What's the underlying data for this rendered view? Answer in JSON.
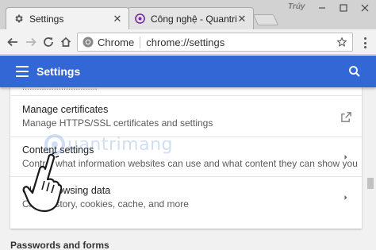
{
  "tabs": [
    {
      "title": "Settings",
      "icon": "gear-icon",
      "active": true
    },
    {
      "title": "Công nghệ - Quantrimang",
      "icon": "quantrimang-icon",
      "active": false
    }
  ],
  "window_user_label": "Trúy",
  "omnibox": {
    "chip": "Chrome",
    "url": "chrome://settings"
  },
  "header": {
    "title": "Settings"
  },
  "cut_text": "...............................",
  "rows": [
    {
      "title": "Manage certificates",
      "subtitle": "Manage HTTPS/SSL certificates and settings",
      "action": "external-link-icon"
    },
    {
      "title": "Content settings",
      "subtitle": "Control what information websites can use and what content they can show you",
      "action": "chevron-right-icon"
    },
    {
      "title": "Clear browsing data",
      "subtitle": "Clear history, cookies, cache, and more",
      "action": "chevron-right-icon"
    }
  ],
  "section_label": "Passwords and forms",
  "colors": {
    "header": "#3367d6",
    "background": "#f1f1f1"
  }
}
